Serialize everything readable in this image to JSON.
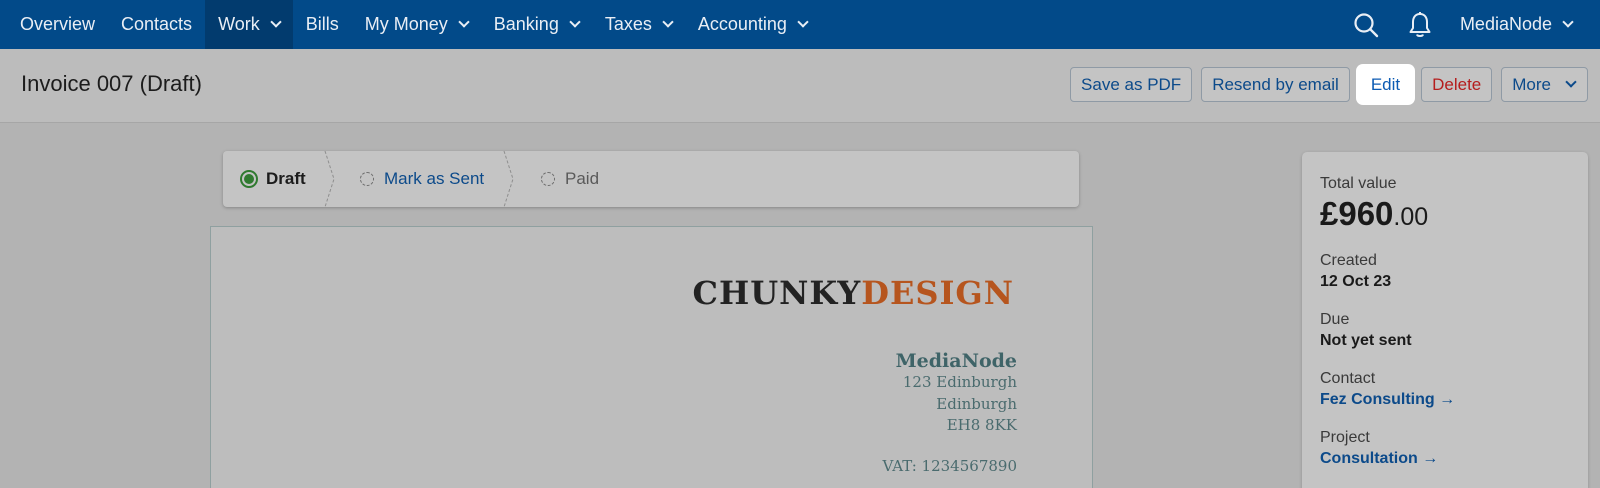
{
  "nav": {
    "items": [
      {
        "label": "Overview",
        "has_menu": false
      },
      {
        "label": "Contacts",
        "has_menu": false
      },
      {
        "label": "Work",
        "has_menu": true,
        "active": true
      },
      {
        "label": "Bills",
        "has_menu": false
      },
      {
        "label": "My Money",
        "has_menu": true
      },
      {
        "label": "Banking",
        "has_menu": true
      },
      {
        "label": "Taxes",
        "has_menu": true
      },
      {
        "label": "Accounting",
        "has_menu": true
      }
    ],
    "user": "MediaNode",
    "icons": [
      "search-icon",
      "bell-icon"
    ],
    "bg_color": "#024a89"
  },
  "header": {
    "title": "Invoice 007 (Draft)",
    "actions": {
      "save_pdf": "Save as PDF",
      "resend": "Resend by email",
      "edit": "Edit",
      "delete": "Delete",
      "more": "More"
    }
  },
  "stepper": {
    "draft": "Draft",
    "mark_sent": "Mark as Sent",
    "paid": "Paid",
    "active_color": "#2f7a2f"
  },
  "invoice": {
    "logo_part1": "CHUNKY",
    "logo_part2": "DESIGN",
    "logo_color": "#b6551e",
    "company": "MediaNode",
    "address_line1": "123 Edinburgh",
    "address_line2": "Edinburgh",
    "address_line3": "EH8 8KK",
    "vat": "VAT: 1234567890"
  },
  "summary": {
    "total_label": "Total value",
    "total_main": "£960",
    "total_decimal": ".00",
    "created_label": "Created",
    "created_value": "12 Oct 23",
    "due_label": "Due",
    "due_value": "Not yet sent",
    "contact_label": "Contact",
    "contact_value": "Fez Consulting →",
    "project_label": "Project",
    "project_value": "Consultation →"
  }
}
